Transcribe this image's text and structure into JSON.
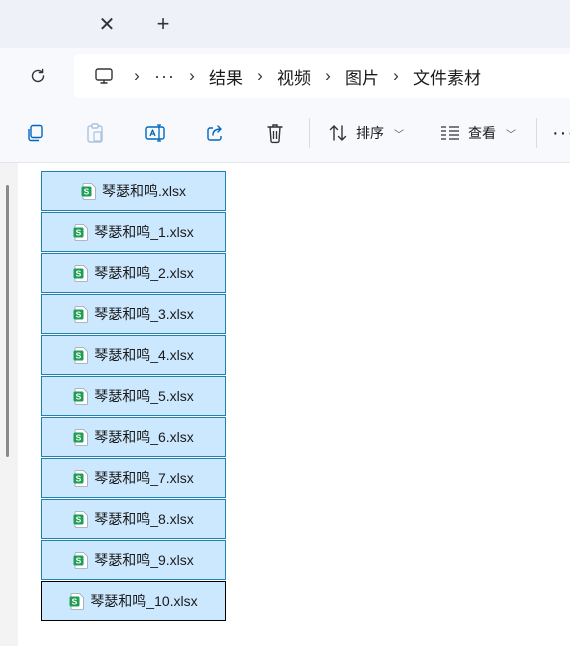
{
  "tabs": {
    "close_glyph": "✕",
    "new_glyph": "+"
  },
  "address": {
    "overflow": "···",
    "crumbs": [
      "结果",
      "视频",
      "图片",
      "文件素材"
    ]
  },
  "toolbar": {
    "sort_label": "排序",
    "view_label": "查看",
    "more": "···"
  },
  "files": [
    "琴瑟和鸣.xlsx",
    "琴瑟和鸣_1.xlsx",
    "琴瑟和鸣_2.xlsx",
    "琴瑟和鸣_3.xlsx",
    "琴瑟和鸣_4.xlsx",
    "琴瑟和鸣_5.xlsx",
    "琴瑟和鸣_6.xlsx",
    "琴瑟和鸣_7.xlsx",
    "琴瑟和鸣_8.xlsx",
    "琴瑟和鸣_9.xlsx",
    "琴瑟和鸣_10.xlsx"
  ],
  "colors": {
    "selection_fill": "#cce8ff",
    "selection_border": "#1e83b0",
    "sheet_icon_green": "#1f9d55"
  },
  "icons": [
    "close-icon",
    "plus-icon",
    "refresh-icon",
    "computer-icon",
    "copy-icon",
    "paste-icon",
    "rename-icon",
    "share-icon",
    "delete-icon",
    "sort-icon",
    "view-icon",
    "more-icon",
    "spreadsheet-file-icon"
  ]
}
